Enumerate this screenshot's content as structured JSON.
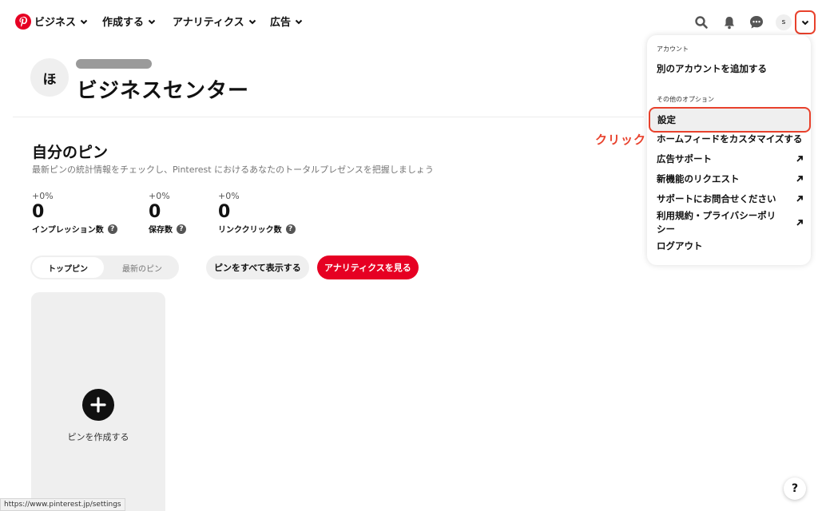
{
  "nav": {
    "logo_icon": "pinterest-logo",
    "items": [
      {
        "label": "ビジネス"
      },
      {
        "label": "作成する"
      },
      {
        "label": "アナリティクス"
      },
      {
        "label": "広告"
      }
    ],
    "icons": [
      "search-icon",
      "bell-icon",
      "message-icon"
    ],
    "avatar_initial": "s",
    "account_toggle_icon": "chevron-down-icon"
  },
  "header": {
    "avatar_initial": "ほ",
    "title": "ビジネスセンター"
  },
  "pins_section": {
    "title": "自分のピン",
    "subtitle": "最新ピンの統計情報をチェックし、Pinterest におけるあなたのトータルプレゼンスを把握しましょう",
    "stats": [
      {
        "change": "+0%",
        "value": "0",
        "label": "インプレッション数"
      },
      {
        "change": "+0%",
        "value": "0",
        "label": "保存数"
      },
      {
        "change": "+0%",
        "value": "0",
        "label": "リンククリック数"
      }
    ],
    "tabs": {
      "active": "トップピン",
      "inactive": "最新のピン"
    },
    "show_all_button": "ピンをすべて表示する",
    "analytics_button": "アナリティクスを見る",
    "create_pin_label": "ピンを作成する"
  },
  "dropdown": {
    "account_section": "アカウント",
    "add_account": "別のアカウントを追加する",
    "more_options_section": "その他のオプション",
    "settings": "設定",
    "items": [
      {
        "label": "ホームフィードをカスタマイズする",
        "external": false
      },
      {
        "label": "広告サポート",
        "external": true
      },
      {
        "label": "新機能のリクエスト",
        "external": true
      },
      {
        "label": "サポートにお問合せください",
        "external": true
      },
      {
        "label": "利用規約・プライバシーポリシー",
        "external": true
      },
      {
        "label": "ログアウト",
        "external": false
      }
    ]
  },
  "annotation": {
    "click_label": "クリック"
  },
  "status_bar": {
    "url": "https://www.pinterest.jp/settings"
  },
  "help_button": "?",
  "colors": {
    "brand_red": "#e60023",
    "annotation_red": "#e8412c"
  }
}
